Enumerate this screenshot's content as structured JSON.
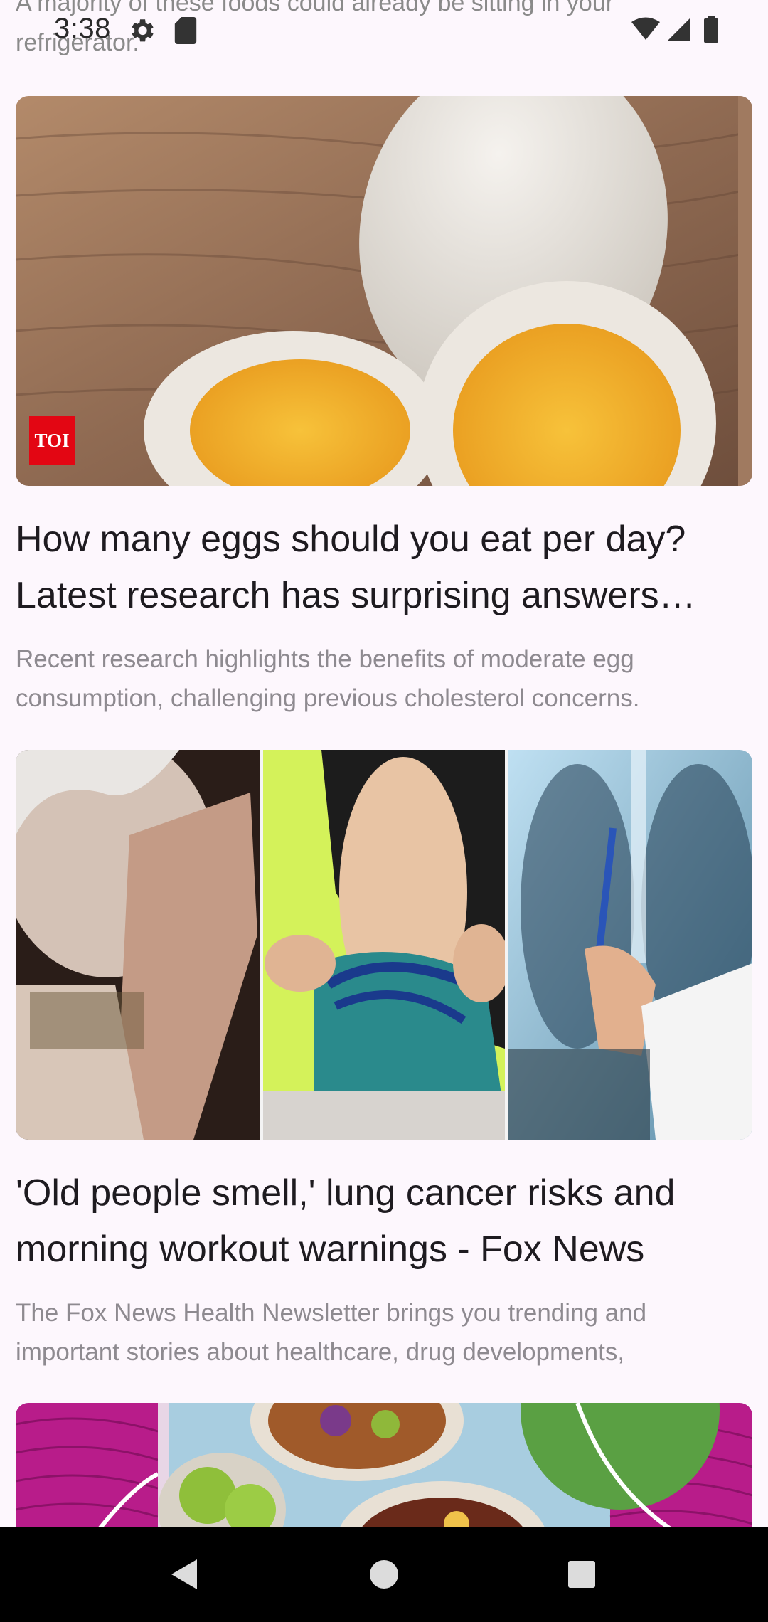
{
  "status_bar": {
    "time": "3:38",
    "icons": [
      "gear-icon",
      "sd-card-icon",
      "wifi-icon",
      "signal-icon",
      "battery-icon"
    ]
  },
  "previous_card": {
    "snippet_lines": [
      "A majority of these foods could already be sitting in your",
      "refrigerator."
    ]
  },
  "articles": [
    {
      "title_lines": [
        "How many eggs should you eat per day?",
        "Latest research has surprising answers…"
      ],
      "description_lines": [
        "Recent research highlights the benefits of moderate egg",
        "consumption, challenging previous cholesterol concerns."
      ],
      "source_badge": "TOI",
      "badge_color": "#e30613"
    },
    {
      "title_lines": [
        "'Old people smell,' lung cancer risks and",
        "morning workout warnings - Fox News"
      ],
      "description_lines": [
        "The Fox News Health Newsletter brings you trending and",
        "important stories about healthcare, drug developments,"
      ]
    },
    {
      "title_lines": [],
      "description_lines": []
    }
  ],
  "navigation": {
    "buttons": [
      "back-icon",
      "home-icon",
      "recents-icon"
    ]
  },
  "colors": {
    "background": "#fdf7fd",
    "title": "#1e1b20",
    "description": "#8e8a90",
    "nav_bar": "#000000"
  }
}
